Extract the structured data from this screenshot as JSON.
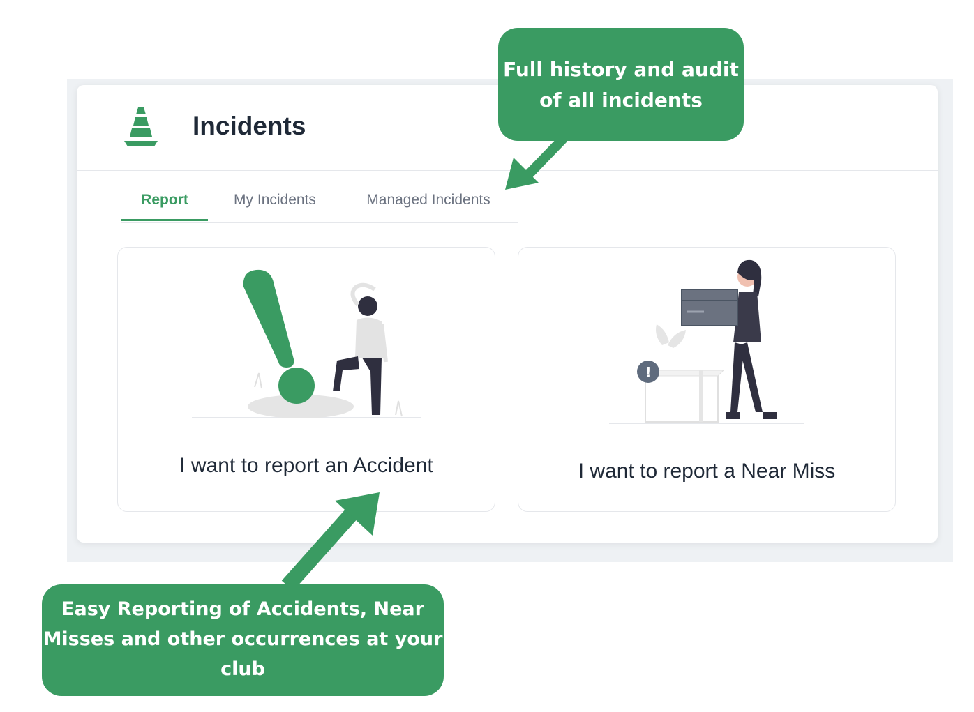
{
  "header": {
    "title": "Incidents",
    "icon": "traffic-cone-icon"
  },
  "tabs": [
    {
      "label": "Report",
      "active": true
    },
    {
      "label": "My Incidents",
      "active": false
    },
    {
      "label": "Managed Incidents",
      "active": false
    }
  ],
  "cards": [
    {
      "label": "I want to report an Accident",
      "illustration": "exclamation-person-icon"
    },
    {
      "label": "I want to report a Near Miss",
      "illustration": "person-carrying-box-icon"
    }
  ],
  "callouts": {
    "history": "Full history and audit of all incidents",
    "reporting": "Easy Reporting of Accidents, Near Misses and other occurrences at your club"
  },
  "colors": {
    "accent": "#3a9b62",
    "text": "#1f2937",
    "muted": "#6b7280",
    "background": "#eef1f4"
  }
}
